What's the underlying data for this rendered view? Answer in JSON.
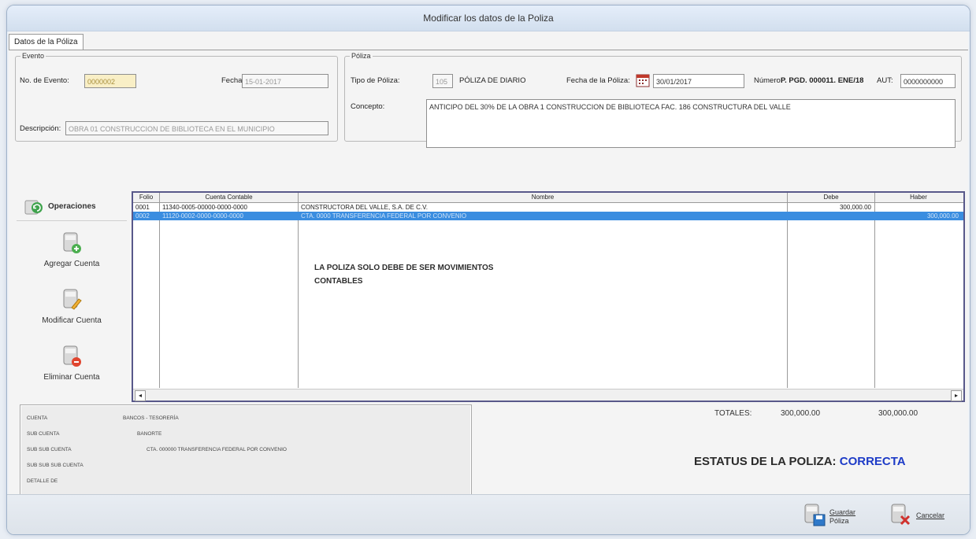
{
  "window": {
    "title": "Modificar los datos de la Poliza"
  },
  "tab": {
    "label": "Datos de la Póliza"
  },
  "evento": {
    "legend": "Evento",
    "num_label": "No. de Evento:",
    "num_value": "0000002",
    "fecha_label": "Fecha:",
    "fecha_value": "15-01-2017",
    "desc_label": "Descripción:",
    "desc_value": "OBRA 01 CONSTRUCCION DE BIBLIOTECA EN EL MUNICIPIO"
  },
  "poliza": {
    "legend": "Póliza",
    "tipo_label": "Tipo de Póliza:",
    "tipo_code": "105",
    "tipo_value": "PÓLIZA DE DIARIO",
    "fecha_label": "Fecha de la Póliza:",
    "fecha_value": "30/01/2017",
    "numero_label": "Número:",
    "numero_value": "P. PGD. 000011. ENE/18",
    "aut_label": "AUT:",
    "aut_value": "0000000000",
    "concepto_label": "Concepto:",
    "concepto_value": "ANTICIPO DEL 30% DE LA OBRA 1 CONSTRUCCION DE BIBLIOTECA FAC. 186 CONSTRUCTURA DEL VALLE"
  },
  "operaciones": {
    "title": "Operaciones",
    "agregar": "Agregar Cuenta",
    "modificar": "Modificar Cuenta",
    "eliminar": "Eliminar Cuenta"
  },
  "grid": {
    "headers": {
      "folio": "Folio",
      "cuenta": "Cuenta Contable",
      "nombre": "Nombre",
      "debe": "Debe",
      "haber": "Haber"
    },
    "rows": [
      {
        "folio": "0001",
        "cuenta": "11340-0005-00000-0000-0000",
        "nombre": "CONSTRUCTORA DEL VALLE, S.A. DE C.V.",
        "debe": "300,000.00",
        "haber": ""
      },
      {
        "folio": "0002",
        "cuenta": "11120-0002-0000-0000-0000",
        "nombre": "CTA. 0000 TRANSFERENCIA FEDERAL POR CONVENIO",
        "debe": "",
        "haber": "300,000.00"
      }
    ],
    "message_line1": "LA POLIZA SOLO DEBE DE SER MOVIMIENTOS",
    "message_line2": "CONTABLES"
  },
  "info": {
    "rows": [
      {
        "label": "CUENTA",
        "value": "BANCOS - TESORERÍA"
      },
      {
        "label": "SUB CUENTA",
        "value": "BANORTE"
      },
      {
        "label": "SUB SUB CUENTA",
        "value": "CTA. 000000 TRANSFERENCIA FEDERAL POR CONVENIO"
      },
      {
        "label": "SUB SUB SUB CUENTA",
        "value": ""
      },
      {
        "label": "DETALLE DE",
        "value": ""
      }
    ]
  },
  "totales": {
    "label": "TOTALES:",
    "debe": "300,000.00",
    "haber": "300,000.00"
  },
  "estatus": {
    "label": "ESTATUS DE LA POLIZA:",
    "value": "CORRECTA"
  },
  "footer": {
    "guardar_line1": "Guardar",
    "guardar_line2": "Póliza",
    "cancelar": "Cancelar"
  }
}
